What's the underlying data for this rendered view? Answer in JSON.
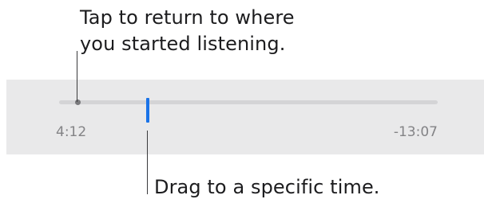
{
  "callouts": {
    "start_line1": "Tap to return to where",
    "start_line2": "you started listening.",
    "scrub": "Drag to a specific time."
  },
  "player": {
    "elapsed_time": "4:12",
    "remaining_time": "-13:07",
    "playhead_fraction": 0.24,
    "start_position_fraction": 0.04
  },
  "colors": {
    "bar_background": "#e9e9ea",
    "track": "#d4d4d6",
    "scrubber": "#1a73e8",
    "time_text": "#838386",
    "callout_text": "#1c1c1e"
  }
}
